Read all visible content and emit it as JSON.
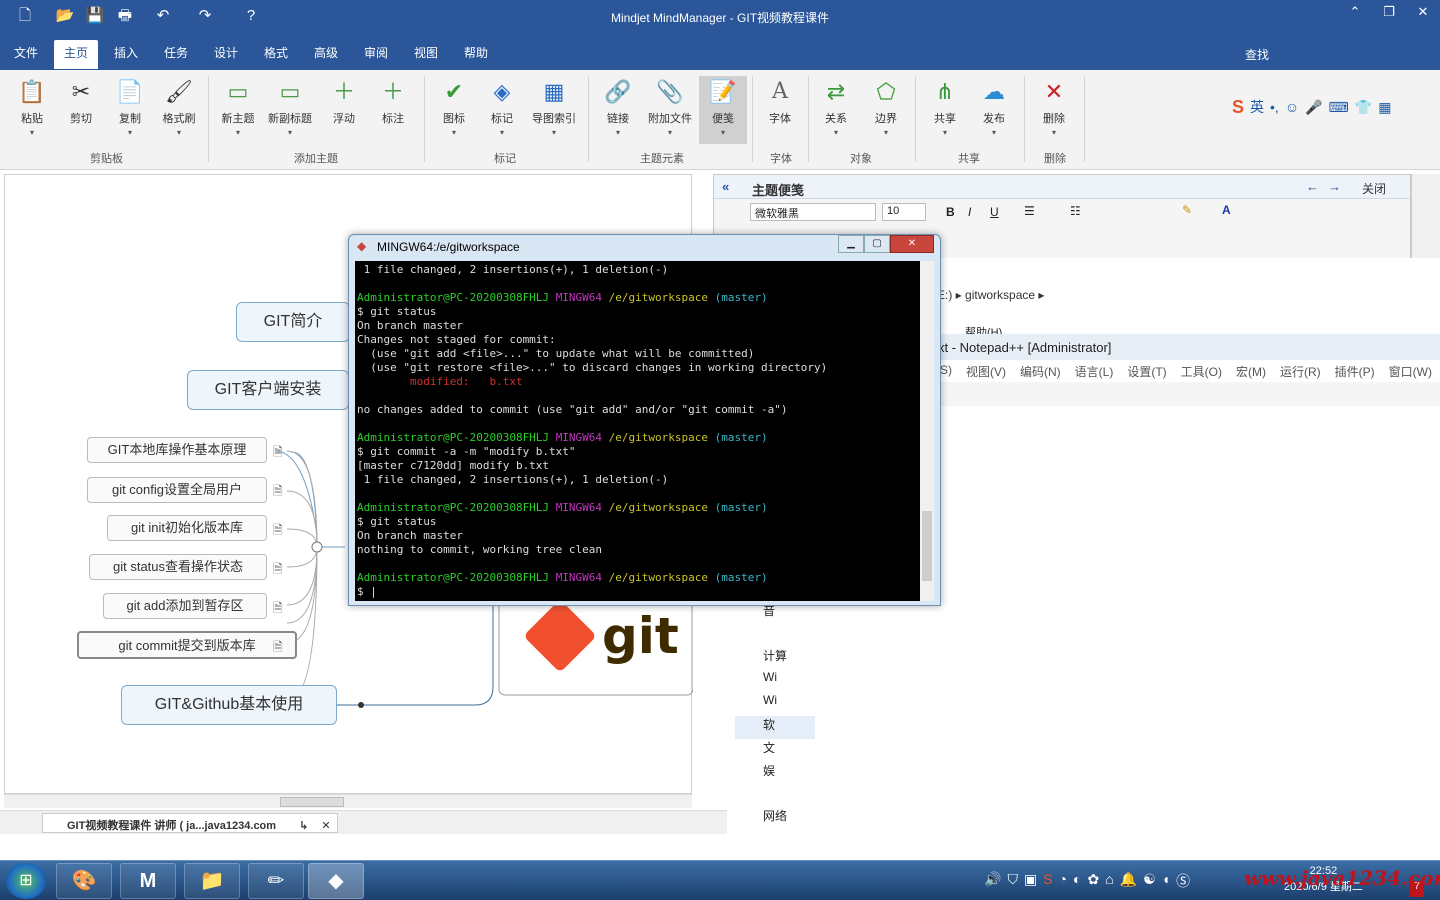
{
  "window": {
    "title": "Mindjet MindManager - GIT视频教程课件",
    "minimize": "⌃",
    "restore": "❐",
    "close": "✕"
  },
  "quick_access": {
    "new_icon": "new-doc",
    "open_icon": "open-folder",
    "save_icon": "save",
    "print_icon": "print",
    "undo_icon": "undo",
    "redo_icon": "redo",
    "help_icon": "help"
  },
  "tabs": [
    "文件",
    "主页",
    "插入",
    "任务",
    "设计",
    "格式",
    "高级",
    "审阅",
    "视图",
    "帮助"
  ],
  "active_tab": "主页",
  "search_label": "查找",
  "ribbon": {
    "buttons": [
      {
        "label": "粘贴",
        "icon": "📋"
      },
      {
        "label": "剪切",
        "icon": "✂"
      },
      {
        "label": "复制",
        "icon": "📄"
      },
      {
        "label": "格式刷",
        "icon": "🖌"
      },
      {
        "label": "新主题",
        "icon": "▭"
      },
      {
        "label": "新副标题",
        "icon": "▭"
      },
      {
        "label": "浮动",
        "icon": "＋"
      },
      {
        "label": "标注",
        "icon": "＋"
      },
      {
        "label": "图标",
        "icon": "✔"
      },
      {
        "label": "标记",
        "icon": "◈"
      },
      {
        "label": "导图索引",
        "icon": "▦"
      },
      {
        "label": "链接",
        "icon": "🔗"
      },
      {
        "label": "附加文件",
        "icon": "📎"
      },
      {
        "label": "便笺",
        "icon": "📝"
      },
      {
        "label": "字体",
        "icon": "A"
      },
      {
        "label": "关系",
        "icon": "⇄"
      },
      {
        "label": "边界",
        "icon": "⬠"
      },
      {
        "label": "共享",
        "icon": "⋔"
      },
      {
        "label": "发布",
        "icon": "☁"
      },
      {
        "label": "删除",
        "icon": "✕"
      }
    ],
    "groups": [
      "剪贴板",
      "添加主题",
      "标记",
      "主题元素",
      "字体",
      "对象",
      "共享",
      "删除"
    ]
  },
  "ime": {
    "logo": "S",
    "mode": "英",
    "punct": "•,",
    "icons": [
      "☺",
      "🎤",
      "⌨",
      "👕",
      "▦"
    ]
  },
  "mindmap": {
    "main_nodes": [
      "GIT简介",
      "GIT客户端安装",
      "GIT&Github基本使用"
    ],
    "sub_nodes": [
      "GIT本地库操作基本原理",
      "git config设置全局用户",
      "git init初始化版本库",
      "git status查看操作状态",
      "git add添加到暂存区",
      "git commit提交到版本库"
    ],
    "git_logo_text": "git"
  },
  "doc_tab": {
    "label": "GIT视频教程课件 讲师 ( ja...java1234.com",
    "pin": "↳",
    "close": "✕"
  },
  "notes_panel": {
    "title": "主题便笺",
    "close_label": "关闭",
    "font": "微软雅黑",
    "size": "10"
  },
  "explorer": {
    "path_prefix": "E:)",
    "path_folder": "gitworkspace",
    "help_menu": "帮助(H)",
    "tree": [
      "音",
      "计算",
      "Wi",
      "Wi",
      "软",
      "文",
      "娱",
      "网络"
    ]
  },
  "notepad": {
    "title": "xt - Notepad++ [Administrator]",
    "menus": [
      "(S)",
      "视图(V)",
      "编码(N)",
      "语言(L)",
      "设置(T)",
      "工具(O)",
      "宏(M)",
      "运行(R)",
      "插件(P)",
      "窗口(W)"
    ]
  },
  "terminal": {
    "title": "MINGW64:/e/gitworkspace",
    "prompt_user": "Administrator@PC-20200308FHLJ",
    "prompt_env": "MINGW64",
    "prompt_path": "/e/gitworkspace",
    "prompt_branch": "(master)",
    "lines": {
      "l1": " 1 file changed, 2 insertions(+), 1 deletion(-)",
      "c1": "$ git status",
      "o1": "On branch master",
      "o2": "Changes not staged for commit:",
      "o3": "  (use \"git add <file>...\" to update what will be committed)",
      "o4": "  (use \"git restore <file>...\" to discard changes in working directory)",
      "o5": "        modified:   b.txt",
      "o6": "no changes added to commit (use \"git add\" and/or \"git commit -a\")",
      "c2": "$ git commit -a -m \"modify b.txt\"",
      "o7": "[master c7120dd] modify b.txt",
      "o8": " 1 file changed, 2 insertions(+), 1 deletion(-)",
      "c3": "$ git status",
      "o9": "On branch master",
      "o10": "nothing to commit, working tree clean",
      "c4": "$ |"
    }
  },
  "taskbar": {
    "apps": [
      "🎨",
      "M",
      "📁",
      "✏",
      "◆"
    ],
    "tray_icons": [
      "🔊",
      "⛉",
      "▣",
      "S",
      "◔",
      "◐",
      "✿",
      "⌂",
      "🔔",
      "☯",
      "◖",
      "Ⓢ"
    ],
    "clock_time": "22:52",
    "clock_date": "2020/6/9 星期二",
    "badge": "7"
  },
  "watermark": "www.java1234.com"
}
